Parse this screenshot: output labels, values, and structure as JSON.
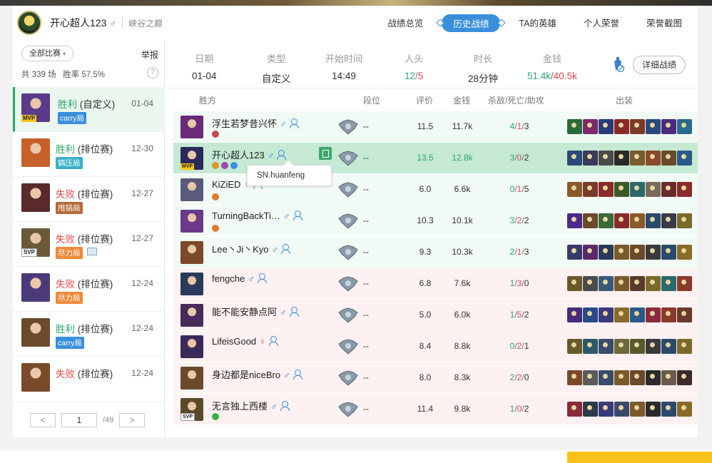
{
  "header": {
    "username": "开心超人123",
    "gender": "♂",
    "region": "峡谷之巅",
    "tabs": [
      {
        "label": "战绩总览",
        "active": false
      },
      {
        "label": "历史战绩",
        "active": true
      },
      {
        "label": "TA的英雄",
        "active": false
      },
      {
        "label": "个人荣誉",
        "active": false
      },
      {
        "label": "荣誉截图",
        "active": false
      }
    ]
  },
  "sidebar": {
    "filter_label": "全部比赛",
    "report_label": "举报",
    "total_label": "共",
    "total_count": "339",
    "total_unit": "场",
    "winrate_label": "胜率",
    "winrate": "57.5%",
    "help": "?",
    "matches": [
      {
        "result": "胜利",
        "mode": "(自定义)",
        "date": "01-04",
        "tag": "carry局",
        "tag_color": "blue",
        "badge": "MVP",
        "win": true,
        "champ_color": "#5b3a8a"
      },
      {
        "result": "胜利",
        "mode": "(排位赛)",
        "date": "12-30",
        "tag": "镉压局",
        "tag_color": "teal",
        "badge": "",
        "win": true,
        "champ_color": "#c8602a"
      },
      {
        "result": "失败",
        "mode": "(排位赛)",
        "date": "12-27",
        "tag": "甩锅局",
        "tag_color": "brown",
        "badge": "",
        "win": false,
        "champ_color": "#5a2a2a"
      },
      {
        "result": "失败",
        "mode": "(排位赛)",
        "date": "12-27",
        "tag": "尽力局",
        "tag_color": "orange",
        "badge": "SVP",
        "win": false,
        "champ_color": "#6a5a3a"
      },
      {
        "result": "失败",
        "mode": "(排位赛)",
        "date": "12-24",
        "tag": "尽力局",
        "tag_color": "orange",
        "badge": "",
        "win": false,
        "champ_color": "#4a3a7a"
      },
      {
        "result": "胜利",
        "mode": "(排位赛)",
        "date": "12-24",
        "tag": "carry局",
        "tag_color": "blue",
        "badge": "",
        "win": true,
        "champ_color": "#6a4a2a"
      },
      {
        "result": "失败",
        "mode": "(排位赛)",
        "date": "12-24",
        "tag": "",
        "tag_color": "",
        "badge": "",
        "win": false,
        "champ_color": "#7a4a2a"
      }
    ],
    "pager": {
      "prev": "<",
      "page": "1",
      "total": "/49",
      "next": ">"
    }
  },
  "summary": {
    "cols": [
      {
        "label": "日期",
        "value": "01-04"
      },
      {
        "label": "类型",
        "value": "自定义"
      },
      {
        "label": "开始时间",
        "value": "14:49"
      }
    ],
    "kills_label": "人头",
    "kills_a": "12",
    "kills_sep": "/",
    "kills_b": "5",
    "duration_label": "时长",
    "duration": "28分钟",
    "gold_label": "金钱",
    "gold_a": "51.4k",
    "gold_b": "40.5k",
    "detail_button": "详细战绩"
  },
  "table": {
    "headers": {
      "side": "胜方",
      "rank": "段位",
      "score": "评价",
      "gold": "金钱",
      "kda": "杀敌/死亡/助攻",
      "items": "出装"
    },
    "tooltip": "SN.huanfeng",
    "rows": [
      {
        "name": "浮生若梦昔兴怀",
        "gender": "♂",
        "rank": "--",
        "score": "11.5",
        "gold": "11.7k",
        "k": "4",
        "d": "1",
        "a": "3",
        "side": "w",
        "badge": "",
        "champ": "#6a2a7a",
        "honors": [
          "#c84a4a"
        ],
        "items": [
          "#2a6a3a",
          "#7a2a6a",
          "#2a3a7a",
          "#8a2a2a",
          "#7a3a2a",
          "#2a4a7a",
          "#4a2a7a",
          "#2a6a8a"
        ]
      },
      {
        "name": "开心超人123",
        "gender": "♂",
        "rank": "--",
        "score": "13.5",
        "gold": "12.8k",
        "k": "3",
        "d": "0",
        "a": "2",
        "side": "hl",
        "badge": "MVP",
        "champ": "#2a2a5a",
        "honors": [
          "#d49a2a",
          "#9a4ab0",
          "#3a8fdc"
        ],
        "items": [
          "#2a4a7a",
          "#3a3a5a",
          "#4a4a4a",
          "#2a2a2a",
          "#7a5a2a",
          "#8a4a2a",
          "#6a4a2a",
          "#2a5a8a"
        ]
      },
      {
        "name": "KiZiED",
        "gender": "♀",
        "rank": "--",
        "score": "6.0",
        "gold": "6.6k",
        "k": "0",
        "d": "1",
        "a": "5",
        "side": "w",
        "badge": "",
        "champ": "#5a5a7a",
        "honors": [
          "#e07a2a"
        ],
        "items": [
          "#8a5a2a",
          "#7a3a2a",
          "#8a2a2a",
          "#3a5a2a",
          "#2a6a6a",
          "#7a6a5a",
          "#6a2a2a",
          "#8a2a2a"
        ]
      },
      {
        "name": "TurningBackTi…",
        "gender": "♂",
        "rank": "--",
        "score": "10.3",
        "gold": "10.1k",
        "k": "3",
        "d": "2",
        "a": "2",
        "side": "w",
        "badge": "",
        "champ": "#6a3a8a",
        "honors": [
          "#e07a2a"
        ],
        "items": [
          "#4a2a8a",
          "#6a4a2a",
          "#3a6a3a",
          "#8a2a2a",
          "#8a5a2a",
          "#2a4a6a",
          "#3a3a4a",
          "#7a6a2a"
        ]
      },
      {
        "name": "Lee丶Ji丶Kyo",
        "gender": "♂",
        "rank": "--",
        "score": "9.3",
        "gold": "10.3k",
        "k": "2",
        "d": "1",
        "a": "3",
        "side": "w",
        "badge": "",
        "champ": "#7a4a2a",
        "honors": [],
        "items": [
          "#3a3a6a",
          "#5a2a6a",
          "#2a3a5a",
          "#7a5a2a",
          "#6a4a2a",
          "#3a3a3a",
          "#2a4a6a",
          "#8a6a2a"
        ]
      },
      {
        "name": "fengche",
        "gender": "♂",
        "rank": "--",
        "score": "6.8",
        "gold": "7.6k",
        "k": "1",
        "d": "3",
        "a": "0",
        "side": "l",
        "badge": "",
        "champ": "#2a3a5a",
        "honors": [],
        "items": [
          "#6a5a2a",
          "#4a4a4a",
          "#3a5a7a",
          "#7a5a2a",
          "#5a3a2a",
          "#7a6a2a",
          "#2a6a6a",
          "#8a3a2a"
        ]
      },
      {
        "name": "能不能安静点阿",
        "gender": "♂",
        "rank": "--",
        "score": "5.0",
        "gold": "6.0k",
        "k": "1",
        "d": "5",
        "a": "2",
        "side": "l",
        "badge": "",
        "champ": "#4a2a5a",
        "honors": [],
        "items": [
          "#4a2a7a",
          "#2a4a8a",
          "#3a3a7a",
          "#8a6a2a",
          "#2a5a8a",
          "#8a2a3a",
          "#8a3a2a",
          "#6a3a2a"
        ]
      },
      {
        "name": "LifeisGood",
        "gender": "♀",
        "rank": "--",
        "score": "8.4",
        "gold": "8.8k",
        "k": "0",
        "d": "2",
        "a": "1",
        "side": "l",
        "badge": "",
        "champ": "#3a2a5a",
        "honors": [],
        "items": [
          "#6a5a2a",
          "#2a5a6a",
          "#3a4a6a",
          "#6a6a3a",
          "#5a5a2a",
          "#3a3a3a",
          "#2a4a6a",
          "#7a6a2a"
        ]
      },
      {
        "name": "身边都是niceBro",
        "gender": "♂",
        "rank": "--",
        "score": "8.0",
        "gold": "8.3k",
        "k": "2",
        "d": "2",
        "a": "0",
        "side": "l",
        "badge": "",
        "champ": "#6a4a2a",
        "honors": [],
        "items": [
          "#7a4a2a",
          "#5a5a5a",
          "#3a4a6a",
          "#7a5a2a",
          "#6a4a2a",
          "#2a2a2a",
          "#6a5a4a",
          "#3a2a2a"
        ]
      },
      {
        "name": "无言独上西楼",
        "gender": "♂",
        "rank": "--",
        "score": "11.4",
        "gold": "9.8k",
        "k": "1",
        "d": "0",
        "a": "2",
        "side": "l",
        "badge": "SVP",
        "champ": "#5a4a2a",
        "honors": [
          "#3ab04a"
        ],
        "items": [
          "#8a2a3a",
          "#2a3a4a",
          "#3a3a7a",
          "#3a4a6a",
          "#7a5a2a",
          "#2a2a2a",
          "#2a4a6a",
          "#8a6a2a"
        ]
      }
    ]
  }
}
